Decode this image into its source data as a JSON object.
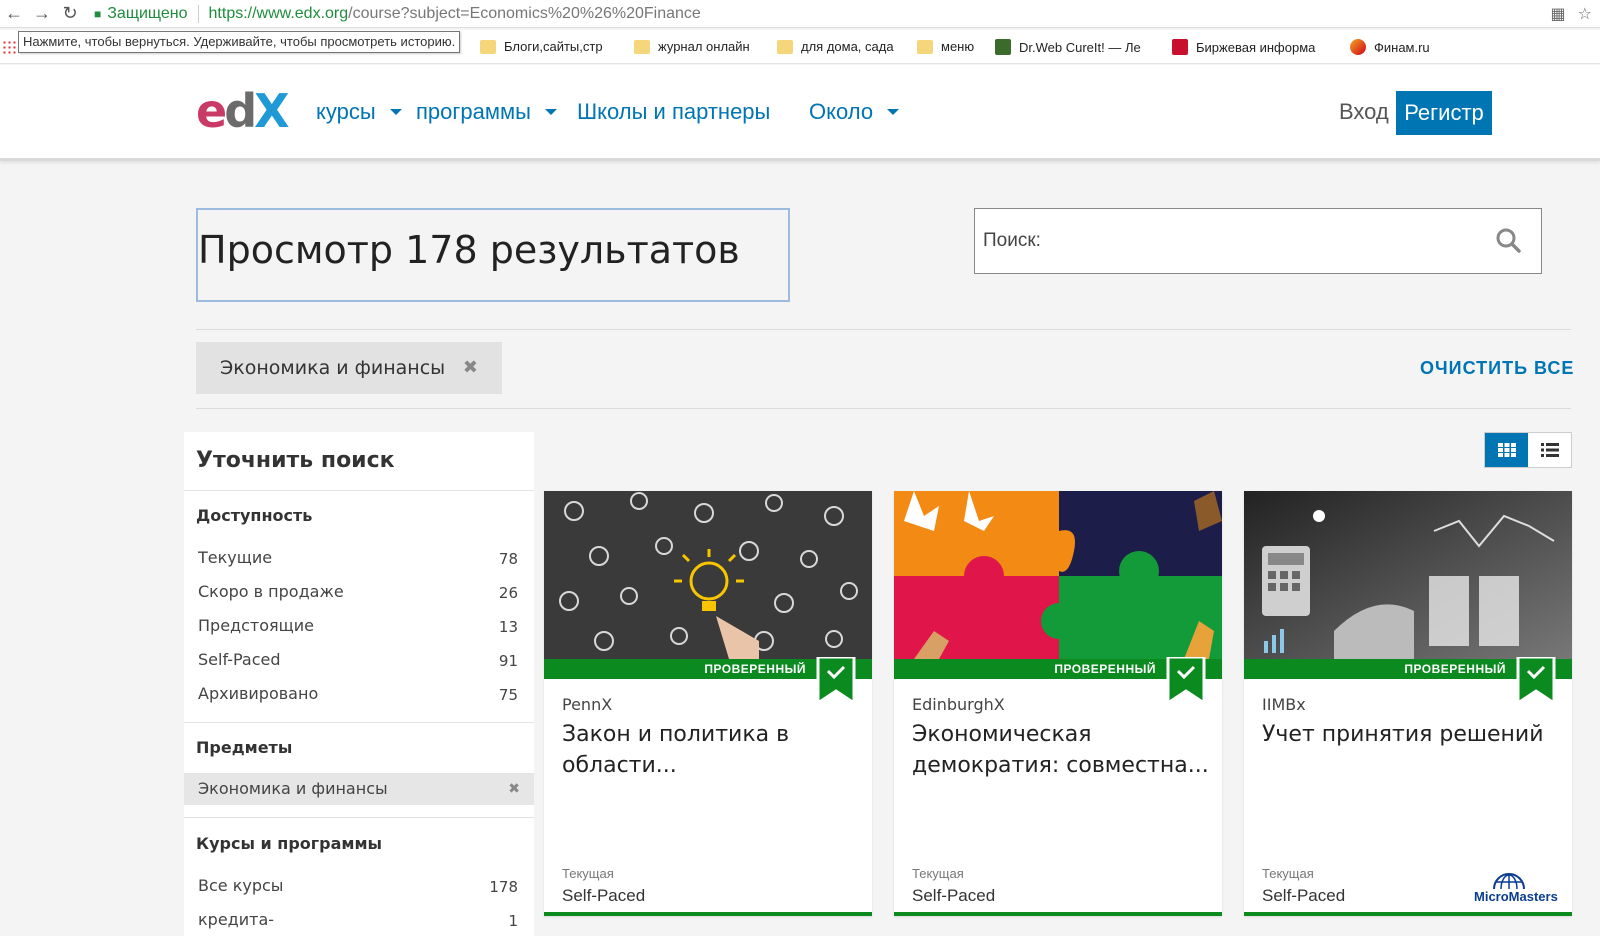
{
  "browser": {
    "secure_label": "Защищено",
    "url_domain": "https://www.edx.org",
    "url_rest": "/course?subject=Economics%20%26%20Finance",
    "tooltip": "Нажмите, чтобы вернуться. Удерживайте, чтобы просмотреть историю.",
    "bookmarks": [
      {
        "label": "Блоги,сайты,стр",
        "icon": "folder-icon"
      },
      {
        "label": "журнал онлайн",
        "icon": "folder-icon"
      },
      {
        "label": "для дома, сада",
        "icon": "folder-icon"
      },
      {
        "label": "меню",
        "icon": "folder-icon"
      },
      {
        "label": "Dr.Web CureIt! — Ле",
        "icon": "drweb-icon"
      },
      {
        "label": "Биржевая информа",
        "icon": "exchange-icon"
      },
      {
        "label": "Финам.ru",
        "icon": "finam-icon"
      }
    ]
  },
  "header": {
    "logo": {
      "e": "e",
      "d": "d",
      "x": "X"
    },
    "nav": [
      {
        "label": "курсы",
        "dropdown": true
      },
      {
        "label": "программы",
        "dropdown": true
      },
      {
        "label": "Школы и партнеры",
        "dropdown": false
      },
      {
        "label": "Около",
        "dropdown": true
      }
    ],
    "login": "Вход",
    "register": "Регистр"
  },
  "results": {
    "title": "Просмотр 178 результатов",
    "search_placeholder": "Поиск:",
    "active_filter": "Экономика и финансы",
    "clear_all": "ОЧИСТИТЬ ВСЕ"
  },
  "sidebar": {
    "title": "Уточнить поиск",
    "availability": {
      "heading": "Доступность",
      "items": [
        {
          "label": "Текущие",
          "count": "78"
        },
        {
          "label": "Скоро в продаже",
          "count": "26"
        },
        {
          "label": "Предстоящие",
          "count": "13"
        },
        {
          "label": "Self-Paced",
          "count": "91"
        },
        {
          "label": "Архивировано",
          "count": "75"
        }
      ]
    },
    "subjects": {
      "heading": "Предметы",
      "selected": "Экономика и финансы"
    },
    "programs": {
      "heading": "Курсы и программы",
      "items": [
        {
          "label": "Все курсы",
          "count": "178"
        },
        {
          "label": "кредита-",
          "count": "1"
        }
      ]
    }
  },
  "cards": [
    {
      "badge": "ПРОВЕРЕННЫЙ",
      "org": "PennX",
      "title": "Закон и политика в области...",
      "status": "Текущая",
      "pace": "Self-Paced",
      "micromasters": false
    },
    {
      "badge": "ПРОВЕРЕННЫЙ",
      "org": "EdinburghX",
      "title": "Экономическая демократия: совместна...",
      "status": "Текущая",
      "pace": "Self-Paced",
      "micromasters": false
    },
    {
      "badge": "ПРОВЕРЕННЫЙ",
      "org": "IIMBx",
      "title": "Учет принятия решений",
      "status": "Текущая",
      "pace": "Self-Paced",
      "micromasters": true,
      "micromasters_label": "MicroMasters"
    }
  ],
  "colors": {
    "accent": "#0075b4",
    "verified": "#0a8a1f"
  }
}
